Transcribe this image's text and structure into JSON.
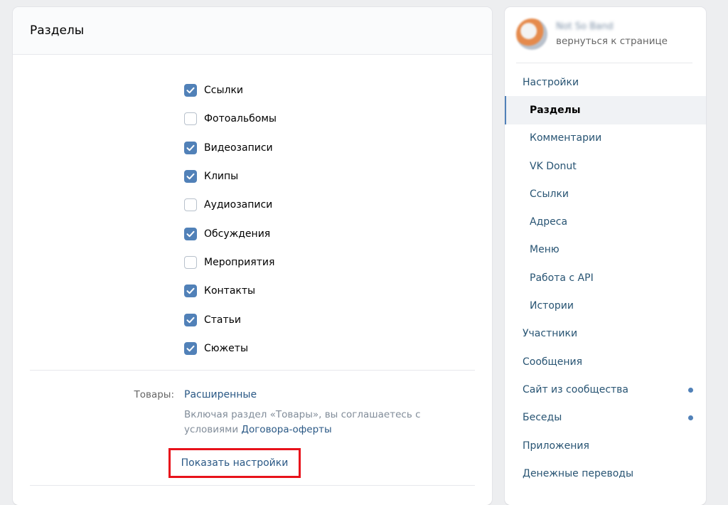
{
  "main": {
    "title": "Разделы",
    "sections": [
      {
        "label": "Ссылки",
        "checked": true
      },
      {
        "label": "Фотоальбомы",
        "checked": false
      },
      {
        "label": "Видеозаписи",
        "checked": true
      },
      {
        "label": "Клипы",
        "checked": true
      },
      {
        "label": "Аудиозаписи",
        "checked": false
      },
      {
        "label": "Обсуждения",
        "checked": true
      },
      {
        "label": "Мероприятия",
        "checked": false
      },
      {
        "label": "Контакты",
        "checked": true
      },
      {
        "label": "Статьи",
        "checked": true
      },
      {
        "label": "Сюжеты",
        "checked": true
      }
    ],
    "goods": {
      "label": "Товары:",
      "value": "Расширенные",
      "note_prefix": "Включая раздел «Товары», вы соглашаетесь с условиями ",
      "note_link": "Договора-оферты",
      "show_settings": "Показать настройки"
    }
  },
  "sidebar": {
    "owner_name": "Not So Band",
    "back_link": "вернуться к странице",
    "items": [
      {
        "label": "Настройки",
        "sub": false,
        "active": false,
        "dot": false
      },
      {
        "label": "Разделы",
        "sub": true,
        "active": true,
        "dot": false
      },
      {
        "label": "Комментарии",
        "sub": true,
        "active": false,
        "dot": false
      },
      {
        "label": "VK Donut",
        "sub": true,
        "active": false,
        "dot": false
      },
      {
        "label": "Ссылки",
        "sub": true,
        "active": false,
        "dot": false
      },
      {
        "label": "Адреса",
        "sub": true,
        "active": false,
        "dot": false
      },
      {
        "label": "Меню",
        "sub": true,
        "active": false,
        "dot": false
      },
      {
        "label": "Работа с API",
        "sub": true,
        "active": false,
        "dot": false
      },
      {
        "label": "Истории",
        "sub": true,
        "active": false,
        "dot": false
      },
      {
        "label": "Участники",
        "sub": false,
        "active": false,
        "dot": false
      },
      {
        "label": "Сообщения",
        "sub": false,
        "active": false,
        "dot": false
      },
      {
        "label": "Сайт из сообщества",
        "sub": false,
        "active": false,
        "dot": true
      },
      {
        "label": "Беседы",
        "sub": false,
        "active": false,
        "dot": true
      },
      {
        "label": "Приложения",
        "sub": false,
        "active": false,
        "dot": false
      },
      {
        "label": "Денежные переводы",
        "sub": false,
        "active": false,
        "dot": false
      }
    ]
  },
  "colors": {
    "accent": "#5181b8",
    "link": "#2a5885",
    "highlight_border": "#e8121b",
    "background": "#edeef0"
  }
}
